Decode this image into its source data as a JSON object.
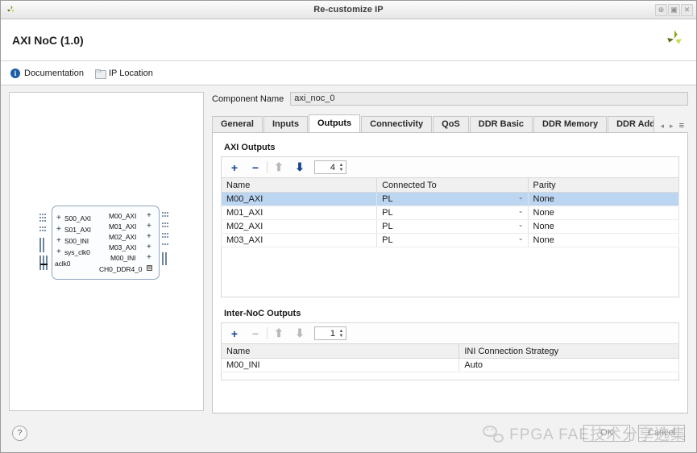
{
  "window": {
    "title": "Re-customize IP",
    "logo_icon": "xilinx-logo-icon",
    "controls": [
      {
        "name": "pin-button",
        "glyph": "⊕"
      },
      {
        "name": "maximize-button",
        "glyph": "▣"
      },
      {
        "name": "close-button",
        "glyph": "✕"
      }
    ]
  },
  "header": {
    "ip_title": "AXI NoC (1.0)",
    "logo_icon": "xilinx-logo-icon"
  },
  "links": {
    "documentation": {
      "label": "Documentation",
      "icon": "info-icon",
      "icon_glyph": "i"
    },
    "ip_location": {
      "label": "IP Location",
      "icon": "folder-icon"
    }
  },
  "preview": {
    "block": {
      "left_ports": [
        "S00_AXI",
        "S01_AXI",
        "S00_INI",
        "sys_clk0",
        "aclk0"
      ],
      "right_ports": [
        "M00_AXI",
        "M01_AXI",
        "M02_AXI",
        "M03_AXI",
        "M00_INI",
        "CH0_DDR4_0"
      ],
      "expand_glyph": "+",
      "ch_icon_glyph": "⊠"
    }
  },
  "component": {
    "label": "Component Name",
    "value": "axi_noc_0"
  },
  "tabs": {
    "items": [
      {
        "label": "General",
        "active": false
      },
      {
        "label": "Inputs",
        "active": false
      },
      {
        "label": "Outputs",
        "active": true
      },
      {
        "label": "Connectivity",
        "active": false
      },
      {
        "label": "QoS",
        "active": false
      },
      {
        "label": "DDR Basic",
        "active": false
      },
      {
        "label": "DDR Memory",
        "active": false
      },
      {
        "label": "DDR Addre",
        "active": false
      }
    ],
    "nav": {
      "prev_glyph": "◂",
      "next_glyph": "▸",
      "menu_glyph": "≡"
    }
  },
  "axi_outputs": {
    "section_title": "AXI Outputs",
    "toolbar": {
      "add_glyph": "+",
      "remove_glyph": "−",
      "up_glyph": "⬆",
      "down_glyph": "⬇",
      "add_enabled": true,
      "remove_enabled": true,
      "up_enabled": false,
      "down_enabled": true,
      "count": "4"
    },
    "columns": [
      "Name",
      "Connected To",
      "Parity"
    ],
    "rows": [
      {
        "name": "M00_AXI",
        "connected_to": "PL",
        "parity": "None",
        "selected": true,
        "dim": false
      },
      {
        "name": "M01_AXI",
        "connected_to": "PL",
        "parity": "None",
        "selected": false,
        "dim": true
      },
      {
        "name": "M02_AXI",
        "connected_to": "PL",
        "parity": "None",
        "selected": false,
        "dim": true
      },
      {
        "name": "M03_AXI",
        "connected_to": "PL",
        "parity": "None",
        "selected": false,
        "dim": true
      }
    ],
    "chevron_glyph": "⌄"
  },
  "inter_noc_outputs": {
    "section_title": "Inter-NoC Outputs",
    "toolbar": {
      "add_glyph": "+",
      "remove_glyph": "−",
      "up_glyph": "⬆",
      "down_glyph": "⬇",
      "add_enabled": true,
      "remove_enabled": false,
      "up_enabled": false,
      "down_enabled": false,
      "count": "1"
    },
    "columns": [
      "Name",
      "INI Connection Strategy"
    ],
    "rows": [
      {
        "name": "M00_INI",
        "strategy": "Auto",
        "dim": true
      }
    ]
  },
  "footer": {
    "help_glyph": "?",
    "ok_label": "OK",
    "cancel_label": "Cancel"
  },
  "watermark": {
    "text": "FPGA FAE技术分享选集",
    "icon": "wechat-icon"
  },
  "colors": {
    "accent_blue": "#17458f",
    "selection_blue": "#bcd6f2",
    "brand_green": "#9fbe2e",
    "info_blue": "#1c5fa8"
  }
}
